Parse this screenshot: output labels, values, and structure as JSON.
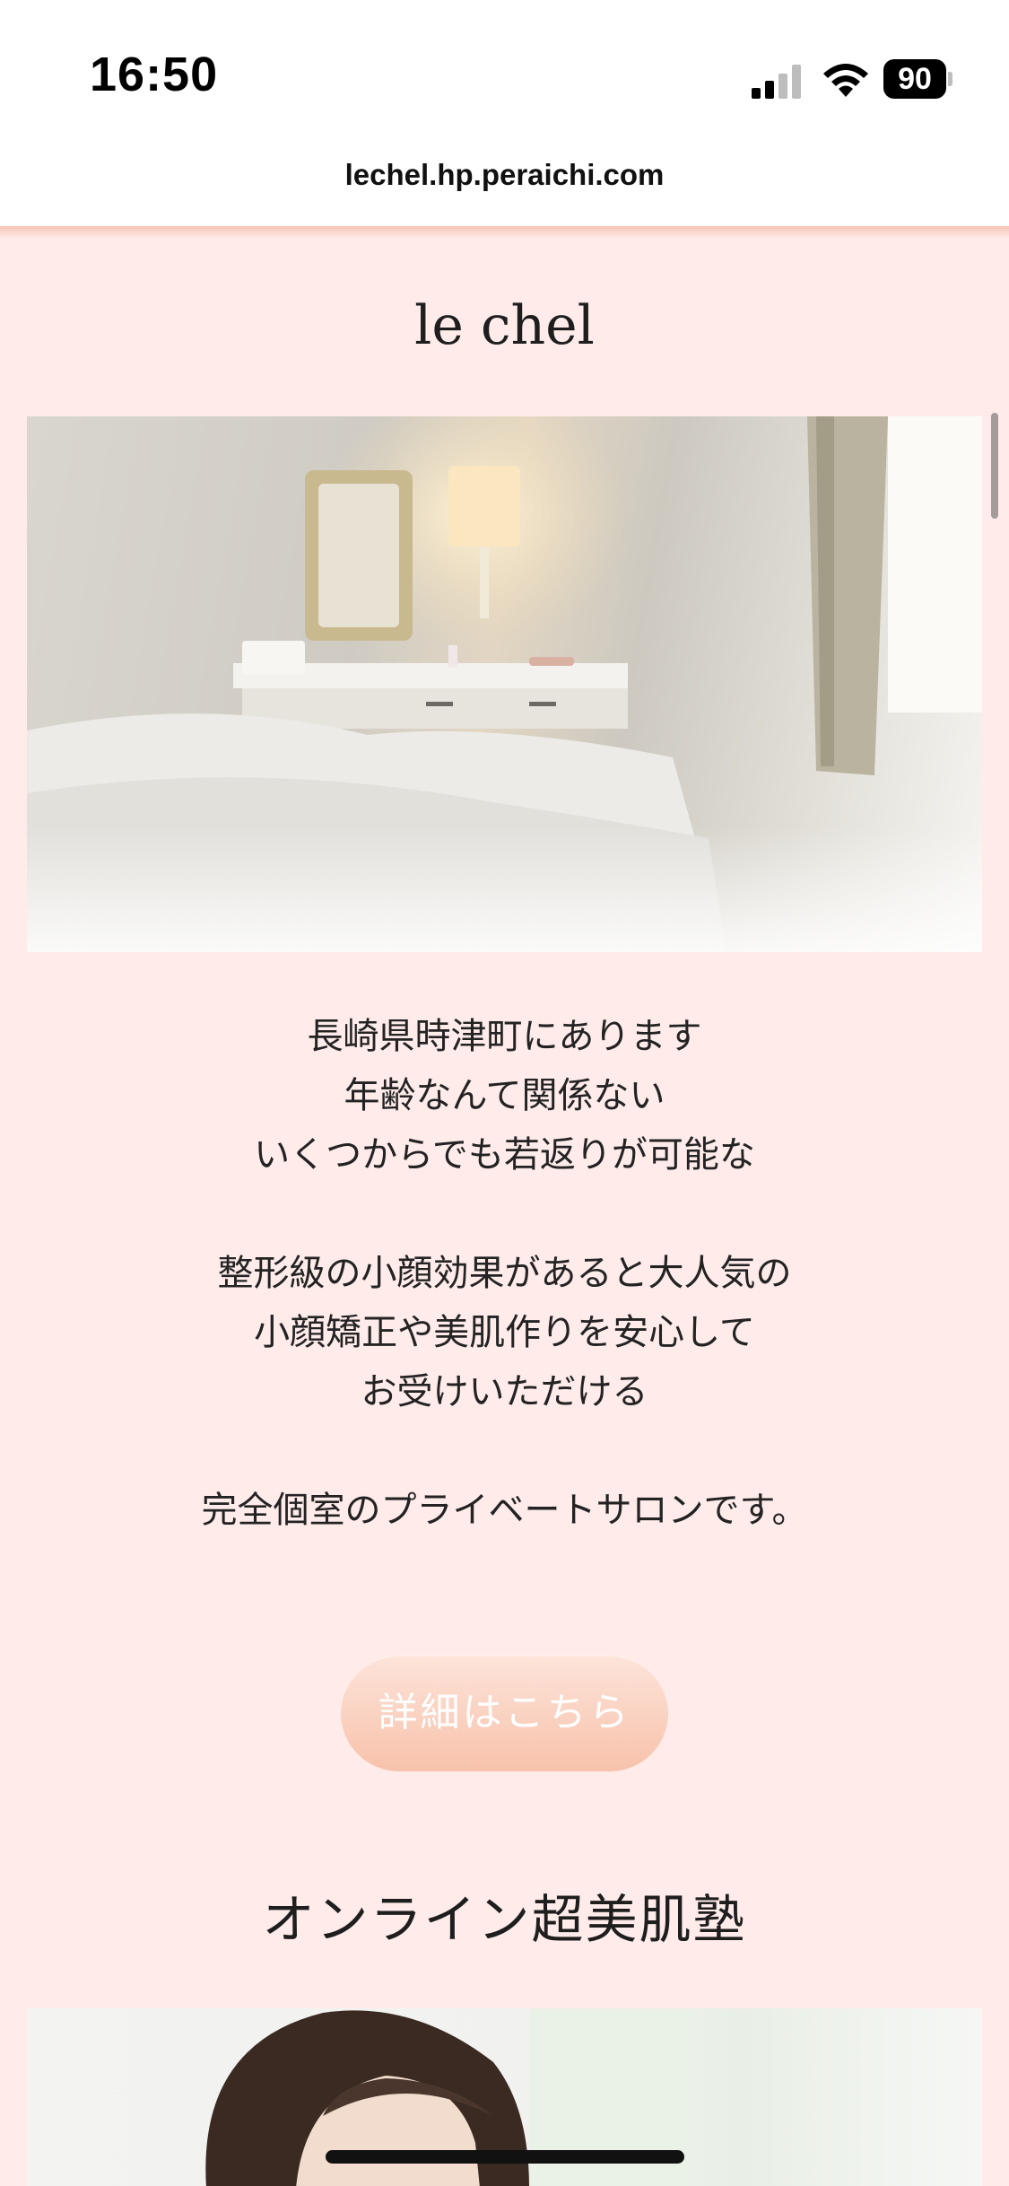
{
  "status_bar": {
    "time": "16:50",
    "battery": "90",
    "icons": [
      "cellular-signal-icon",
      "wifi-icon",
      "battery-icon"
    ]
  },
  "browser": {
    "url": "lechel.hp.peraichi.com"
  },
  "site": {
    "title": "le chel"
  },
  "intro": {
    "line1": "長崎県時津町にあります",
    "line2": "年齢なんて関係ない",
    "line3": "いくつからでも若返りが可能な",
    "line4": "整形級の小顔効果があると大人気の",
    "line5": "小顔矯正や美肌作りを安心して",
    "line6": "お受けいただける",
    "line7": "完全個室のプライベートサロンです。"
  },
  "button": {
    "label": "詳細はこちら"
  },
  "online": {
    "title": "オンライン超美肌塾"
  },
  "colors": {
    "page_background": "#ffecea",
    "button_top": "#fde4da",
    "button_bottom": "#f7c2ab",
    "text": "#232323"
  }
}
